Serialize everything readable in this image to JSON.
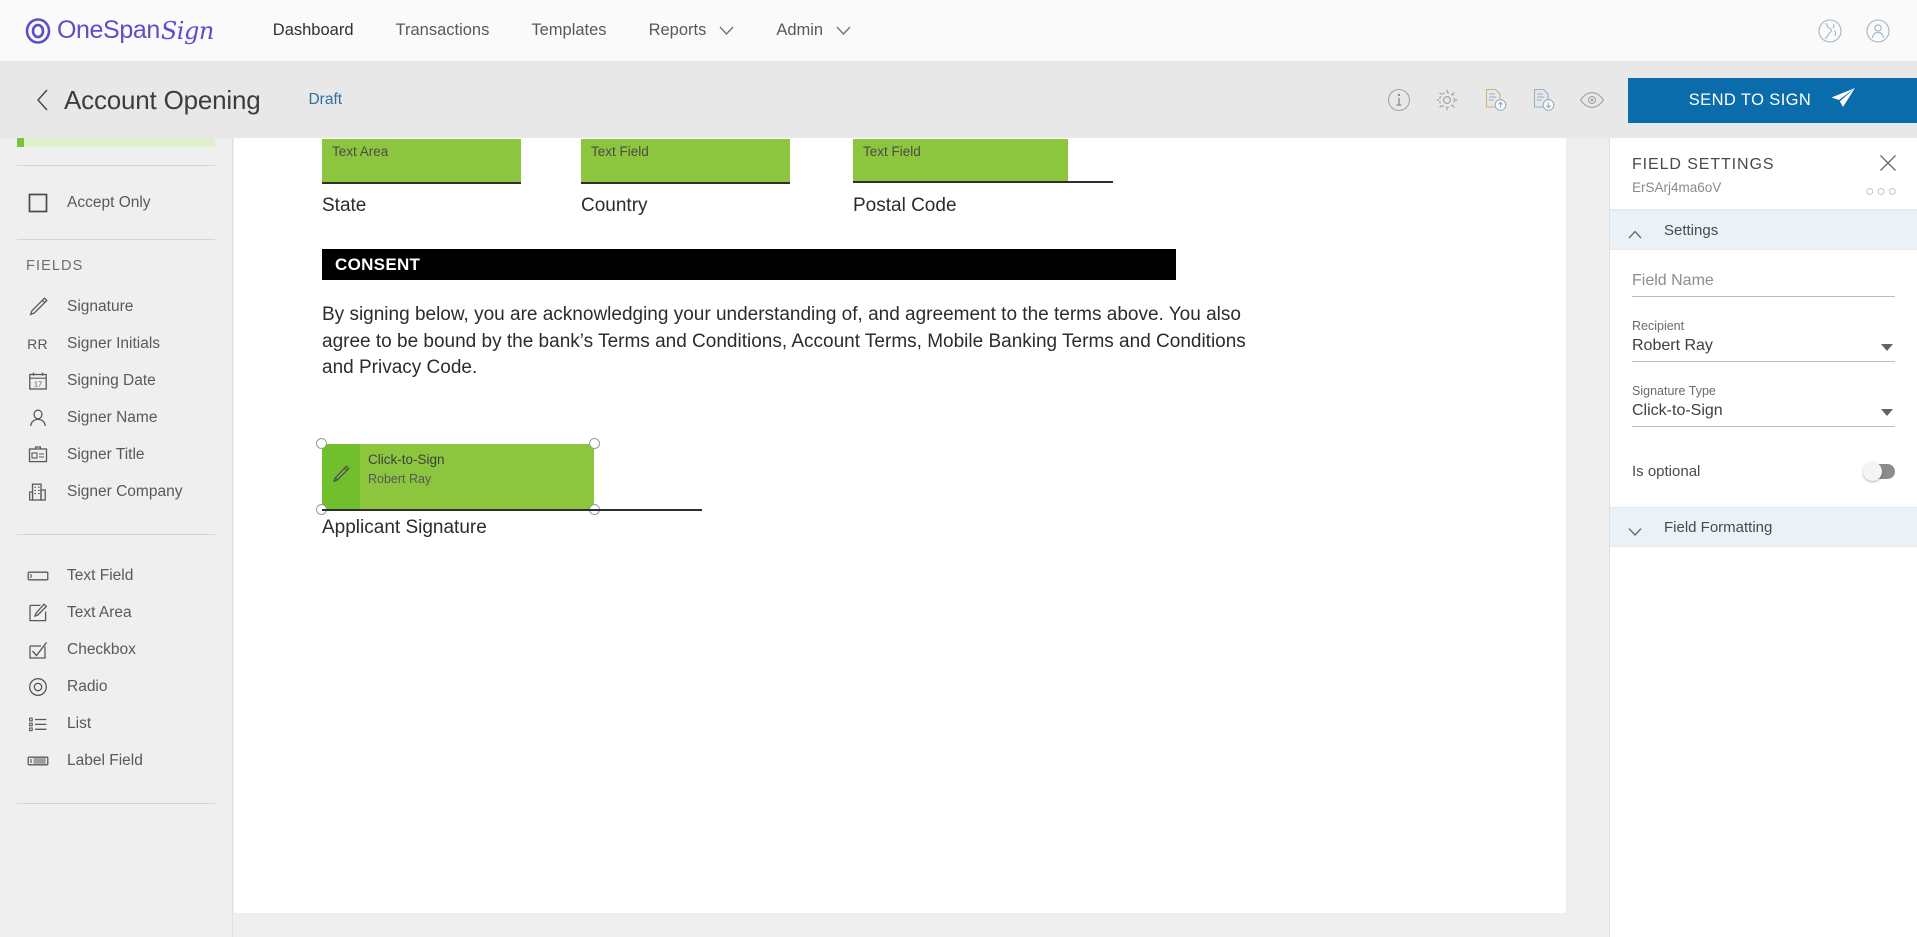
{
  "topnav": {
    "brand": {
      "name_primary": "OneSpan",
      "name_script": "Sign",
      "logo_icon": "onespan-ring-logo"
    },
    "items": [
      {
        "label": "Dashboard",
        "has_caret": false
      },
      {
        "label": "Transactions",
        "has_caret": false
      },
      {
        "label": "Templates",
        "has_caret": false
      },
      {
        "label": "Reports",
        "has_caret": true
      },
      {
        "label": "Admin",
        "has_caret": true
      }
    ],
    "right_icons": [
      {
        "name": "globe-icon"
      },
      {
        "name": "user-account-icon"
      }
    ],
    "brand_color": "#5b4ec9"
  },
  "subheader": {
    "back_icon": "back-chevron-icon",
    "title": "Account Opening",
    "status": "Draft",
    "status_color": "#2f6f9f",
    "tools": [
      {
        "name": "info-icon"
      },
      {
        "name": "settings-gear-icon"
      },
      {
        "name": "document-upload-icon"
      },
      {
        "name": "document-download-icon"
      },
      {
        "name": "preview-eye-icon"
      }
    ],
    "send_button": {
      "label": "SEND TO SIGN",
      "icon": "paper-plane-icon",
      "color": "#0a6cab"
    }
  },
  "sidebar": {
    "top_item": {
      "label": "Accept Only",
      "icon": "checkbox-empty-icon"
    },
    "fields_heading": "FIELDS",
    "signer_fields": [
      {
        "label": "Signature",
        "icon": "pencil-icon"
      },
      {
        "label": "Signer Initials",
        "icon": "initials-rr-icon"
      },
      {
        "label": "Signing Date",
        "icon": "calendar-icon"
      },
      {
        "label": "Signer Name",
        "icon": "person-icon"
      },
      {
        "label": "Signer Title",
        "icon": "id-badge-icon"
      },
      {
        "label": "Signer Company",
        "icon": "building-icon"
      }
    ],
    "input_fields": [
      {
        "label": "Text Field",
        "icon": "text-field-icon"
      },
      {
        "label": "Text Area",
        "icon": "text-area-icon"
      },
      {
        "label": "Checkbox",
        "icon": "checkbox-checked-icon"
      },
      {
        "label": "Radio",
        "icon": "radio-icon"
      },
      {
        "label": "List",
        "icon": "list-icon"
      },
      {
        "label": "Label Field",
        "icon": "label-field-icon"
      }
    ]
  },
  "document": {
    "fields": [
      {
        "type_label": "Text Area",
        "label": "State"
      },
      {
        "type_label": "Text Field",
        "label": "Country"
      },
      {
        "type_label": "Text Field",
        "label": "Postal Code"
      }
    ],
    "consent_heading": "CONSENT",
    "consent_paragraph": "By signing below, you are acknowledging your understanding of, and agreement to the terms above. You also agree to be bound by the bank’s Terms and Conditions, Account Terms, Mobile Banking Terms and Conditions and Privacy Code.",
    "signature_field": {
      "type_label": "Click-to-Sign",
      "signer": "Robert Ray",
      "icon": "pencil-icon",
      "caption": "Applicant Signature",
      "selected": true
    },
    "field_color": "#8cc63f",
    "field_accent_color": "#72bf2e"
  },
  "right_panel": {
    "title": "FIELD SETTINGS",
    "field_id": "ErSArj4ma6oV",
    "close_icon": "close-icon",
    "more_icon": "more-options-icon",
    "sections": [
      {
        "label": "Settings",
        "expanded": true,
        "chevron": "chevron-up-icon"
      },
      {
        "label": "Field Formatting",
        "expanded": false,
        "chevron": "chevron-down-icon"
      }
    ],
    "fields": [
      {
        "name": "field-name",
        "label": "",
        "placeholder": "Field Name",
        "value": ""
      },
      {
        "name": "recipient",
        "label": "Recipient",
        "value": "Robert Ray",
        "is_select": true
      },
      {
        "name": "signature-type",
        "label": "Signature Type",
        "value": "Click-to-Sign",
        "is_select": true
      }
    ],
    "toggle": {
      "label": "Is optional",
      "on": false
    }
  }
}
